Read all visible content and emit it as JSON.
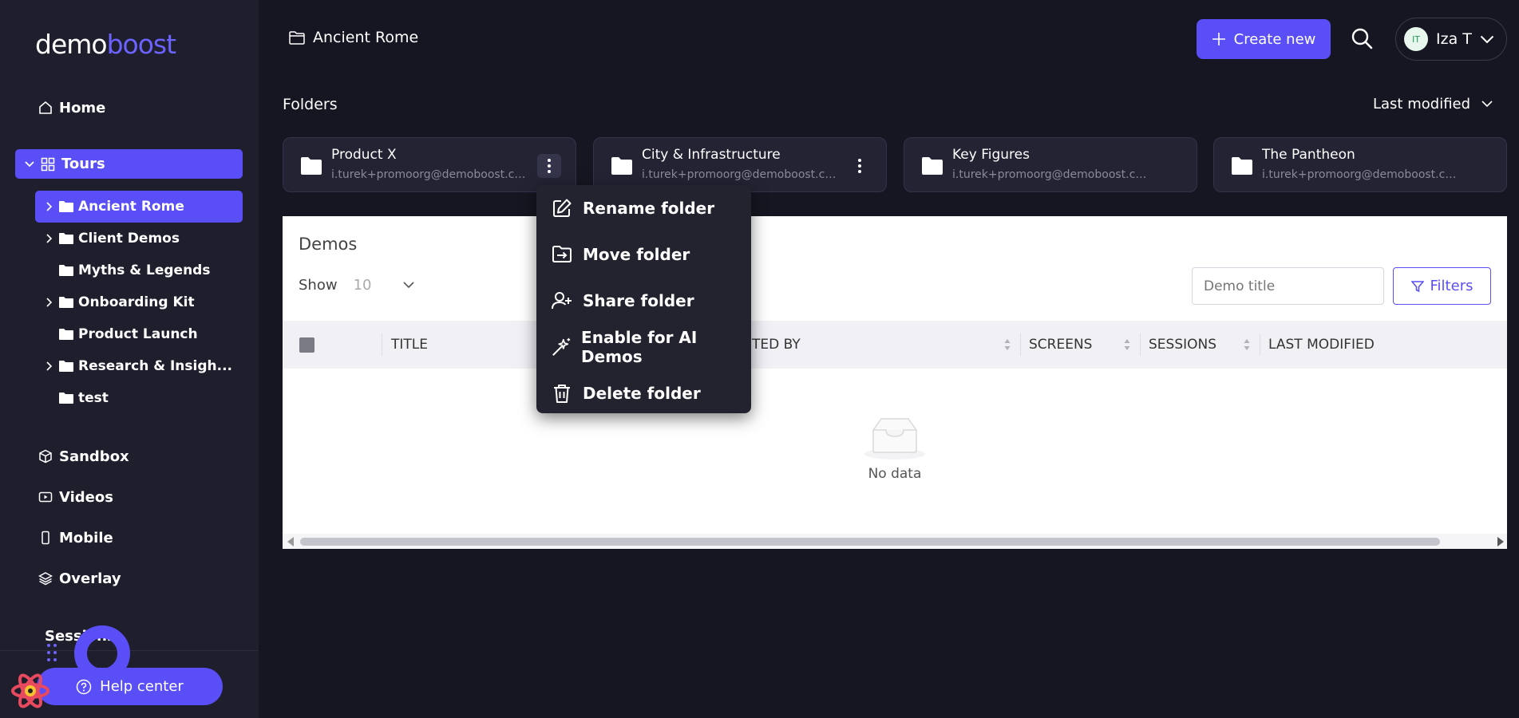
{
  "logo": {
    "part1": "demo",
    "part2": "boost"
  },
  "sidebar": {
    "home": "Home",
    "tours": "Tours",
    "tree": [
      {
        "label": "Ancient Rome",
        "expandable": true,
        "active": true
      },
      {
        "label": "Client Demos",
        "expandable": true,
        "active": false
      },
      {
        "label": "Myths & Legends",
        "expandable": false,
        "active": false
      },
      {
        "label": "Onboarding Kit",
        "expandable": true,
        "active": false
      },
      {
        "label": "Product Launch",
        "expandable": false,
        "active": false
      },
      {
        "label": "Research & Insigh...",
        "expandable": true,
        "active": false
      },
      {
        "label": "test",
        "expandable": false,
        "active": false
      }
    ],
    "sandbox": "Sandbox",
    "videos": "Videos",
    "mobile": "Mobile",
    "overlay": "Overlay",
    "sessions": "Sessions",
    "help": "Help center"
  },
  "header": {
    "breadcrumb": "Ancient Rome",
    "create": "Create new",
    "user_initials": "IT",
    "user_name": "Iza T"
  },
  "folders": {
    "title": "Folders",
    "sort": "Last modified",
    "items": [
      {
        "name": "Product X",
        "owner": "i.turek+promoorg@demoboost.com"
      },
      {
        "name": "City & Infrastructure",
        "owner": "i.turek+promoorg@demoboost.com"
      },
      {
        "name": "Key Figures",
        "owner": "i.turek+promoorg@demoboost.com"
      },
      {
        "name": "The Pantheon",
        "owner": "i.turek+promoorg@demoboost.com"
      }
    ]
  },
  "demos": {
    "title": "Demos",
    "show_label": "Show",
    "show_value": "10",
    "search_placeholder": "Demo title",
    "filters": "Filters",
    "columns": {
      "title": "TITLE",
      "created_by": "TED BY",
      "screens": "SCREENS",
      "sessions": "SESSIONS",
      "last_modified": "LAST MODIFIED"
    },
    "empty": "No data"
  },
  "menu": {
    "rename": "Rename folder",
    "move": "Move folder",
    "share": "Share folder",
    "ai": "Enable for AI Demos",
    "delete": "Delete folder"
  },
  "colors": {
    "accent": "#5a4ff6",
    "bg": "#161622",
    "sidebar": "#1e1e2d"
  }
}
